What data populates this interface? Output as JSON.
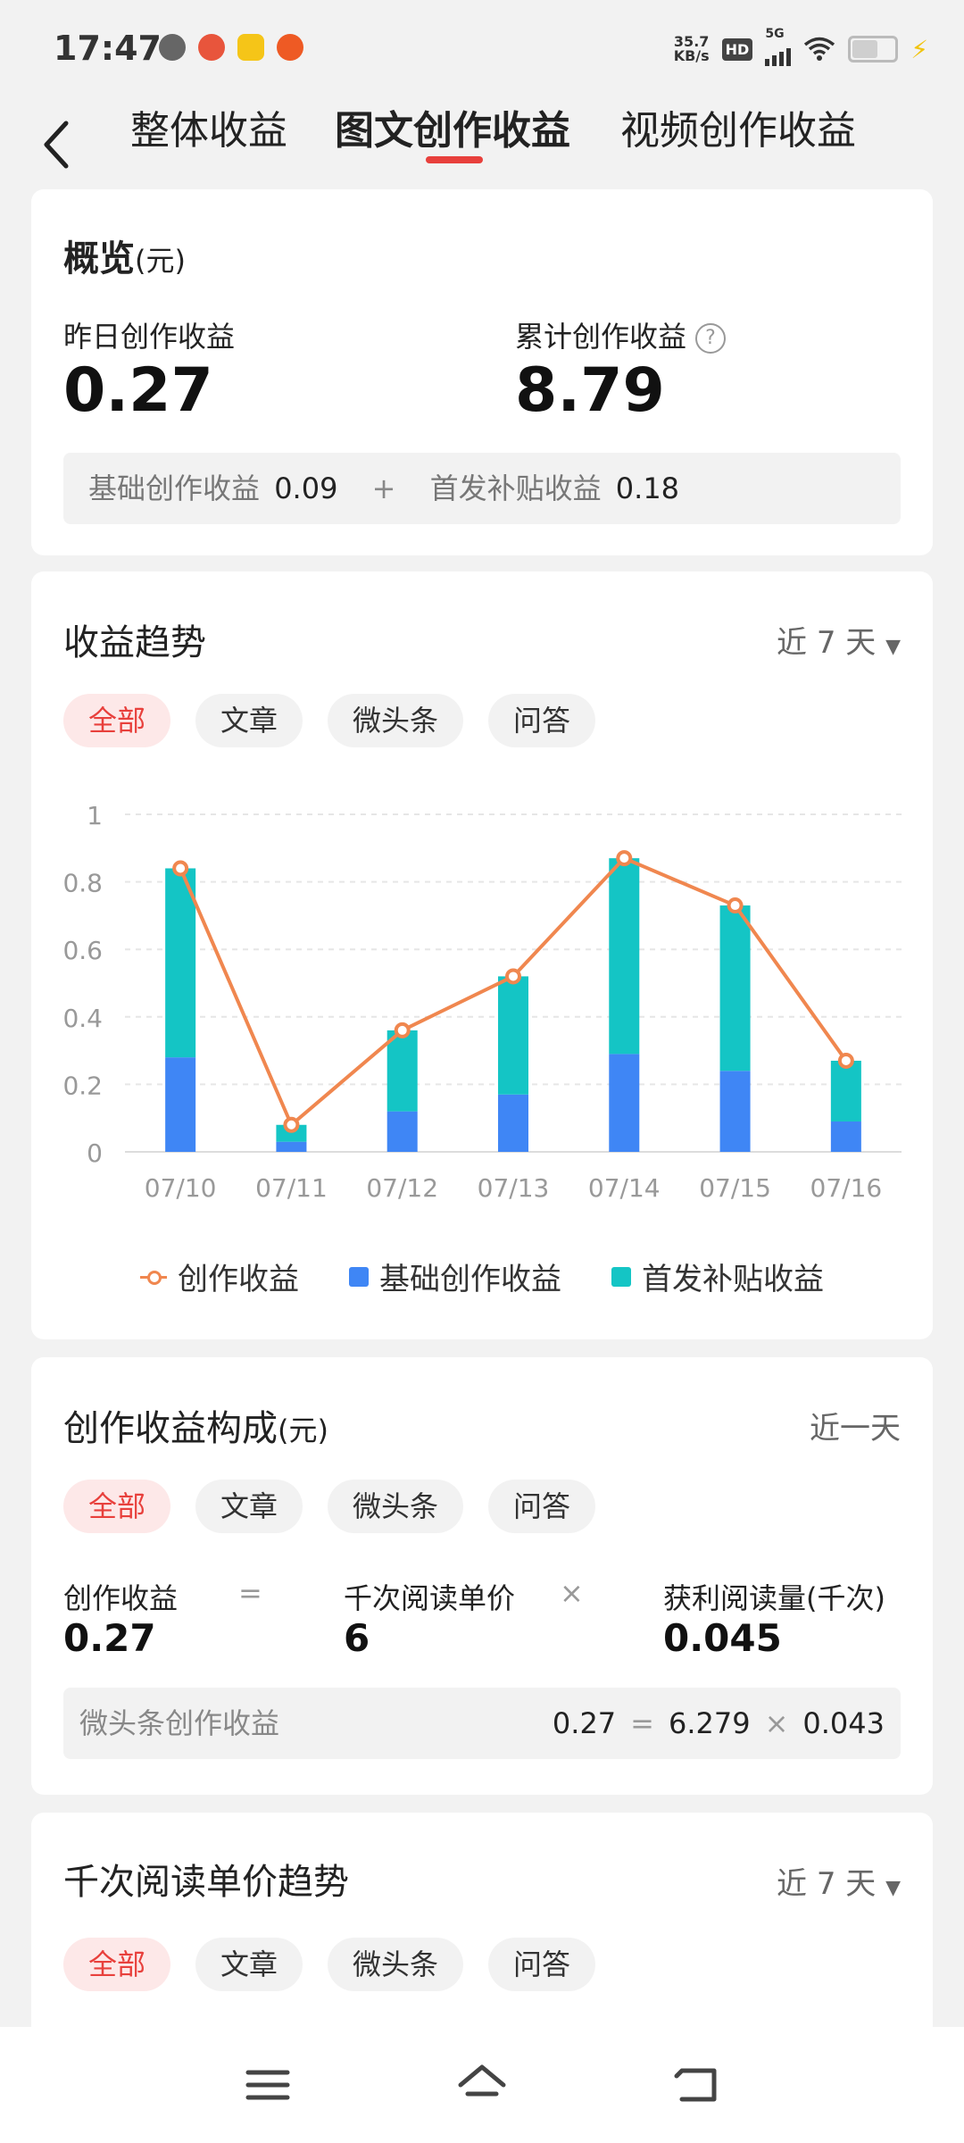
{
  "status_bar": {
    "time": "17:47",
    "net_speed": "35.7",
    "net_unit": "KB/s",
    "hd": "HD",
    "network": "5G"
  },
  "tabs": {
    "items": [
      "整体收益",
      "图文创作收益",
      "视频创作收益"
    ],
    "active": 1
  },
  "overview": {
    "title": "概览",
    "unit": "(元)",
    "yesterday_label": "昨日创作收益",
    "yesterday_value": "0.27",
    "total_label": "累计创作收益",
    "total_value": "8.79",
    "base_label": "基础创作收益",
    "base_value": "0.09",
    "plus": "+",
    "subsidy_label": "首发补贴收益",
    "subsidy_value": "0.18"
  },
  "trend": {
    "title": "收益趋势",
    "range": "近 7 天",
    "pills": [
      "全部",
      "文章",
      "微头条",
      "问答"
    ]
  },
  "chart_data": {
    "type": "bar",
    "categories": [
      "07/10",
      "07/11",
      "07/12",
      "07/13",
      "07/14",
      "07/15",
      "07/16"
    ],
    "series": [
      {
        "name": "基础创作收益",
        "type": "stacked-bar",
        "color": "#3f86f5",
        "values": [
          0.28,
          0.03,
          0.12,
          0.17,
          0.29,
          0.24,
          0.09
        ]
      },
      {
        "name": "首发补贴收益",
        "type": "stacked-bar",
        "color": "#14c5c5",
        "values": [
          0.56,
          0.05,
          0.24,
          0.35,
          0.58,
          0.49,
          0.18
        ]
      },
      {
        "name": "创作收益",
        "type": "line",
        "color": "#f0874f",
        "values": [
          0.84,
          0.08,
          0.36,
          0.52,
          0.87,
          0.73,
          0.27
        ]
      }
    ],
    "y_ticks": [
      "0",
      "0.2",
      "0.4",
      "0.6",
      "0.8",
      "1"
    ],
    "ylim": [
      0,
      1
    ],
    "grid": true,
    "legend_position": "bottom"
  },
  "composition": {
    "title": "创作收益构成",
    "unit": "(元)",
    "range": "近一天",
    "pills": [
      "全部",
      "文章",
      "微头条",
      "问答"
    ],
    "income_label": "创作收益",
    "eq": "=",
    "income_value": "0.27",
    "price_label": "千次阅读单价",
    "times": "×",
    "price_value": "6",
    "reads_label": "获利阅读量(千次)",
    "reads_value": "0.045",
    "row_label": "微头条创作收益",
    "row_income": "0.27",
    "row_eq": "=",
    "row_price": "6.279",
    "row_times": "×",
    "row_reads": "0.043"
  },
  "price_trend": {
    "title": "千次阅读单价趋势",
    "range": "近 7 天",
    "pills": [
      "全部",
      "文章",
      "微头条",
      "问答"
    ]
  }
}
